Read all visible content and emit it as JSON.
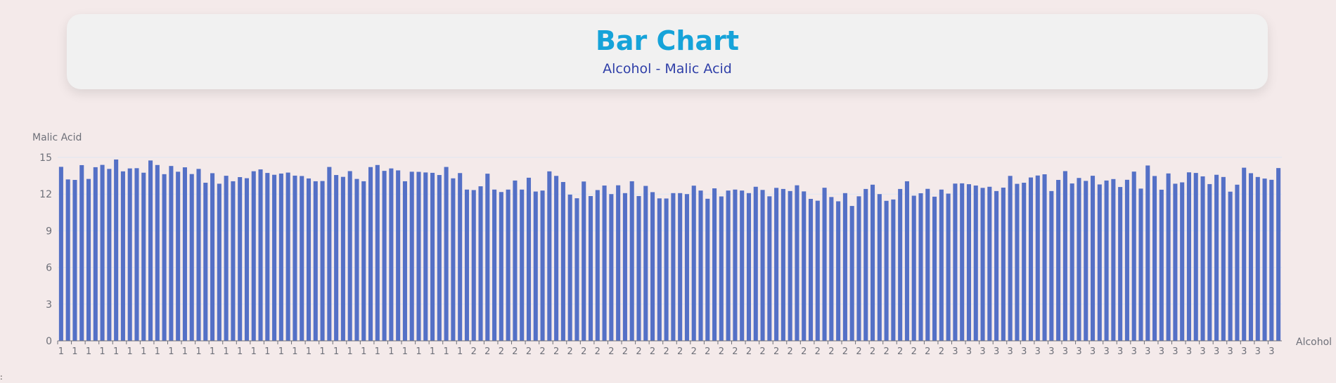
{
  "header": {
    "title": "Bar Chart",
    "subtitle": "Alcohol - Malic Acid"
  },
  "stray_text": ":",
  "chart_data": {
    "type": "bar",
    "title": "Bar Chart",
    "subtitle": "Alcohol - Malic Acid",
    "xlabel": "Alcohol",
    "ylabel": "Malic Acid",
    "ylim": [
      0,
      15
    ],
    "yticks": [
      0,
      3,
      6,
      9,
      12,
      15
    ],
    "grid": true,
    "bar_color": "#5470c6",
    "categories": [
      "1",
      "1",
      "1",
      "1",
      "1",
      "1",
      "1",
      "1",
      "1",
      "1",
      "1",
      "1",
      "1",
      "1",
      "1",
      "1",
      "1",
      "1",
      "1",
      "1",
      "1",
      "1",
      "1",
      "1",
      "1",
      "1",
      "1",
      "1",
      "1",
      "1",
      "1",
      "1",
      "1",
      "1",
      "1",
      "1",
      "1",
      "1",
      "1",
      "1",
      "1",
      "1",
      "1",
      "1",
      "1",
      "1",
      "1",
      "1",
      "1",
      "1",
      "1",
      "1",
      "1",
      "1",
      "1",
      "1",
      "1",
      "1",
      "1",
      "2",
      "2",
      "2",
      "2",
      "2",
      "2",
      "2",
      "2",
      "2",
      "2",
      "2",
      "2",
      "2",
      "2",
      "2",
      "2",
      "2",
      "2",
      "2",
      "2",
      "2",
      "2",
      "2",
      "2",
      "2",
      "2",
      "2",
      "2",
      "2",
      "2",
      "2",
      "2",
      "2",
      "2",
      "2",
      "2",
      "2",
      "2",
      "2",
      "2",
      "2",
      "2",
      "2",
      "2",
      "2",
      "2",
      "2",
      "2",
      "2",
      "2",
      "2",
      "2",
      "2",
      "2",
      "2",
      "2",
      "2",
      "2",
      "2",
      "2",
      "2",
      "2",
      "2",
      "2",
      "2",
      "2",
      "2",
      "2",
      "2",
      "2",
      "2",
      "3",
      "3",
      "3",
      "3",
      "3",
      "3",
      "3",
      "3",
      "3",
      "3",
      "3",
      "3",
      "3",
      "3",
      "3",
      "3",
      "3",
      "3",
      "3",
      "3",
      "3",
      "3",
      "3",
      "3",
      "3",
      "3",
      "3",
      "3",
      "3",
      "3",
      "3",
      "3",
      "3",
      "3",
      "3",
      "3",
      "3",
      "3",
      "3",
      "3",
      "3",
      "3",
      "3",
      "3",
      "3",
      "3",
      "3",
      "3"
    ],
    "values": [
      14.23,
      13.2,
      13.16,
      14.37,
      13.24,
      14.2,
      14.39,
      14.06,
      14.83,
      13.86,
      14.1,
      14.12,
      13.75,
      14.75,
      14.38,
      13.63,
      14.3,
      13.83,
      14.19,
      13.64,
      14.06,
      12.93,
      13.71,
      12.85,
      13.5,
      13.05,
      13.39,
      13.3,
      13.87,
      14.02,
      13.73,
      13.58,
      13.68,
      13.76,
      13.51,
      13.48,
      13.28,
      13.05,
      13.07,
      14.22,
      13.56,
      13.41,
      13.88,
      13.24,
      13.05,
      14.21,
      14.38,
      13.9,
      14.1,
      13.94,
      13.05,
      13.83,
      13.82,
      13.77,
      13.74,
      13.56,
      14.22,
      13.29,
      13.72,
      12.37,
      12.33,
      12.64,
      13.67,
      12.37,
      12.17,
      12.37,
      13.11,
      12.37,
      13.34,
      12.21,
      12.29,
      13.86,
      13.49,
      12.99,
      11.96,
      11.66,
      13.03,
      11.84,
      12.33,
      12.7,
      12.0,
      12.72,
      12.08,
      13.05,
      11.84,
      12.67,
      12.16,
      11.65,
      11.64,
      12.08,
      12.08,
      12.0,
      12.69,
      12.29,
      11.62,
      12.47,
      11.81,
      12.29,
      12.37,
      12.29,
      12.08,
      12.6,
      12.34,
      11.82,
      12.51,
      12.42,
      12.25,
      12.72,
      12.22,
      11.61,
      11.46,
      12.52,
      11.76,
      11.41,
      12.08,
      11.03,
      11.82,
      12.42,
      12.77,
      12.0,
      11.45,
      11.56,
      12.42,
      13.05,
      11.87,
      12.07,
      12.43,
      11.79,
      12.37,
      12.04,
      12.86,
      12.88,
      12.81,
      12.7,
      12.51,
      12.6,
      12.25,
      12.53,
      13.49,
      12.84,
      12.93,
      13.36,
      13.52,
      13.62,
      12.25,
      13.16,
      13.88,
      12.87,
      13.32,
      13.08,
      13.5,
      12.79,
      13.11,
      13.23,
      12.58,
      13.17,
      13.84,
      12.45,
      14.34,
      13.48,
      12.36,
      13.69,
      12.85,
      12.96,
      13.78,
      13.73,
      13.45,
      12.82,
      13.58,
      13.4,
      12.2,
      12.77,
      14.16,
      13.71,
      13.4,
      13.27,
      13.17,
      14.13
    ]
  }
}
